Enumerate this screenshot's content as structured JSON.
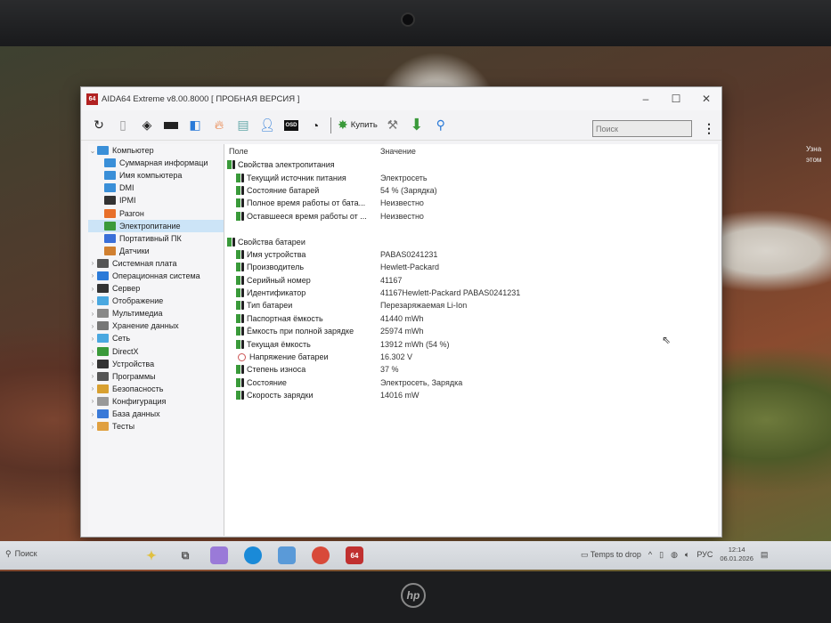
{
  "window": {
    "title": "AIDA64 Extreme v8.00.8000  [ ПРОБНАЯ ВЕРСИЯ ]",
    "app_icon": "64"
  },
  "toolbar": {
    "buy_label": "Купить",
    "search_placeholder": "Поиск",
    "osd": "OSD"
  },
  "tree": [
    {
      "label": "Компьютер",
      "level": 0,
      "expanded": true,
      "color": "#3a8fd8"
    },
    {
      "label": "Суммарная информаци",
      "level": 1,
      "color": "#3a8fd8"
    },
    {
      "label": "Имя компьютера",
      "level": 1,
      "color": "#3a8fd8"
    },
    {
      "label": "DMI",
      "level": 1,
      "color": "#3a8fd8"
    },
    {
      "label": "IPMI",
      "level": 1,
      "color": "#333"
    },
    {
      "label": "Разгон",
      "level": 1,
      "color": "#e8702a"
    },
    {
      "label": "Электропитание",
      "level": 1,
      "selected": true,
      "color": "#3a9a3a"
    },
    {
      "label": "Портативный ПК",
      "level": 1,
      "color": "#3a6fd8"
    },
    {
      "label": "Датчики",
      "level": 1,
      "color": "#d08030"
    },
    {
      "label": "Системная плата",
      "level": 0,
      "color": "#555"
    },
    {
      "label": "Операционная система",
      "level": 0,
      "color": "#2a7ad8"
    },
    {
      "label": "Сервер",
      "level": 0,
      "color": "#333"
    },
    {
      "label": "Отображение",
      "level": 0,
      "color": "#4aa8e0"
    },
    {
      "label": "Мультимедиа",
      "level": 0,
      "color": "#888"
    },
    {
      "label": "Хранение данных",
      "level": 0,
      "color": "#777"
    },
    {
      "label": "Сеть",
      "level": 0,
      "color": "#4aa8e0"
    },
    {
      "label": "DirectX",
      "level": 0,
      "color": "#3a9a3a"
    },
    {
      "label": "Устройства",
      "level": 0,
      "color": "#333"
    },
    {
      "label": "Программы",
      "level": 0,
      "color": "#555"
    },
    {
      "label": "Безопасность",
      "level": 0,
      "color": "#d8a030"
    },
    {
      "label": "Конфигурация",
      "level": 0,
      "color": "#999"
    },
    {
      "label": "База данных",
      "level": 0,
      "color": "#3a7ad8"
    },
    {
      "label": "Тесты",
      "level": 0,
      "color": "#e0a040"
    }
  ],
  "table": {
    "col_field": "Поле",
    "col_value": "Значение",
    "rows": [
      {
        "field": "Свойства электропитания",
        "value": "",
        "group": true
      },
      {
        "field": "Текущий источник питания",
        "value": "Электросеть"
      },
      {
        "field": "Состояние батарей",
        "value": "54 % (Зарядка)"
      },
      {
        "field": "Полное время работы от бата...",
        "value": "Неизвестно"
      },
      {
        "field": "Оставшееся время работы от ...",
        "value": "Неизвестно"
      },
      {
        "field": "",
        "value": "",
        "blank": true
      },
      {
        "field": "Свойства батареи",
        "value": "",
        "group": true
      },
      {
        "field": "Имя устройства",
        "value": "PABAS0241231"
      },
      {
        "field": "Производитель",
        "value": "Hewlett-Packard"
      },
      {
        "field": "Серийный номер",
        "value": "41167"
      },
      {
        "field": "Идентификатор",
        "value": "41167Hewlett-Packard PABAS0241231"
      },
      {
        "field": "Тип батареи",
        "value": "Перезаряжаемая Li-Ion"
      },
      {
        "field": "Паспортная ёмкость",
        "value": "41440 mWh"
      },
      {
        "field": "Ёмкость при полной зарядке",
        "value": "25974 mWh"
      },
      {
        "field": "Текущая ёмкость",
        "value": "13912 mWh  (54 %)"
      },
      {
        "field": "Напряжение батареи",
        "value": "16.302 V",
        "volt": true
      },
      {
        "field": "Степень износа",
        "value": "37 %"
      },
      {
        "field": "Состояние",
        "value": "Электросеть, Зарядка"
      },
      {
        "field": "Скорость зарядки",
        "value": "14016 mW"
      }
    ]
  },
  "desktop": {
    "side_text_1": "Узна",
    "side_text_2": "этом"
  },
  "taskbar": {
    "search": "Поиск",
    "weather": "Temps to drop",
    "lang": "РУС",
    "time": "12:14",
    "date": "06.01.2026",
    "app_64": "64"
  },
  "bezel": {
    "logo": "hp"
  }
}
